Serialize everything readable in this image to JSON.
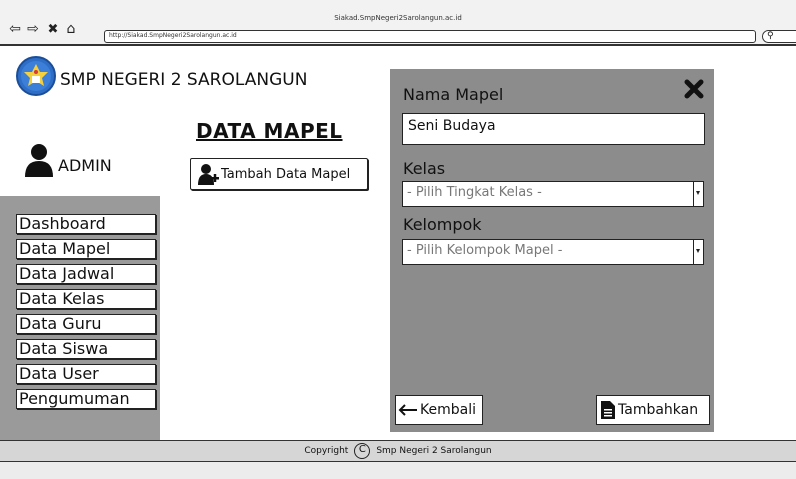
{
  "browser": {
    "page_title": "Siakad.SmpNegeri2Sarolangun.ac.id",
    "url": "http://Siakad.SmpNegeri2Sarolangun.ac.id"
  },
  "header": {
    "school_name": "SMP NEGERI 2 SAROLANGUN",
    "user_label": "ADMIN"
  },
  "main": {
    "heading": "DATA MAPEL",
    "add_button_label": "Tambah Data Mapel"
  },
  "sidebar": {
    "items": [
      {
        "label": "Dashboard"
      },
      {
        "label": "Data Mapel"
      },
      {
        "label": "Data Jadwal"
      },
      {
        "label": "Data Kelas"
      },
      {
        "label": "Data Guru"
      },
      {
        "label": "Data Siswa"
      },
      {
        "label": "Data User"
      },
      {
        "label": "Pengumuman"
      }
    ]
  },
  "modal": {
    "nama_label": "Nama Mapel",
    "nama_value": "Seni Budaya",
    "kelas_label": "Kelas",
    "kelas_selected": "- Pilih Tingkat Kelas -",
    "kelompok_label": "Kelompok",
    "kelompok_selected": "- Pilih Kelompok Mapel -",
    "back_label": "Kembali",
    "submit_label": "Tambahkan"
  },
  "footer": {
    "copyright_prefix": "Copyright",
    "copyright_owner": "Smp Negeri 2 Sarolangun"
  },
  "icons": {
    "back": "back-arrow-icon",
    "forward": "forward-arrow-icon",
    "stop": "close-x-icon",
    "home": "home-icon",
    "search": "search-icon",
    "user": "user-icon",
    "add_user": "add-user-icon",
    "close": "close-icon",
    "arrow_left": "arrow-left-icon",
    "document": "document-icon"
  }
}
